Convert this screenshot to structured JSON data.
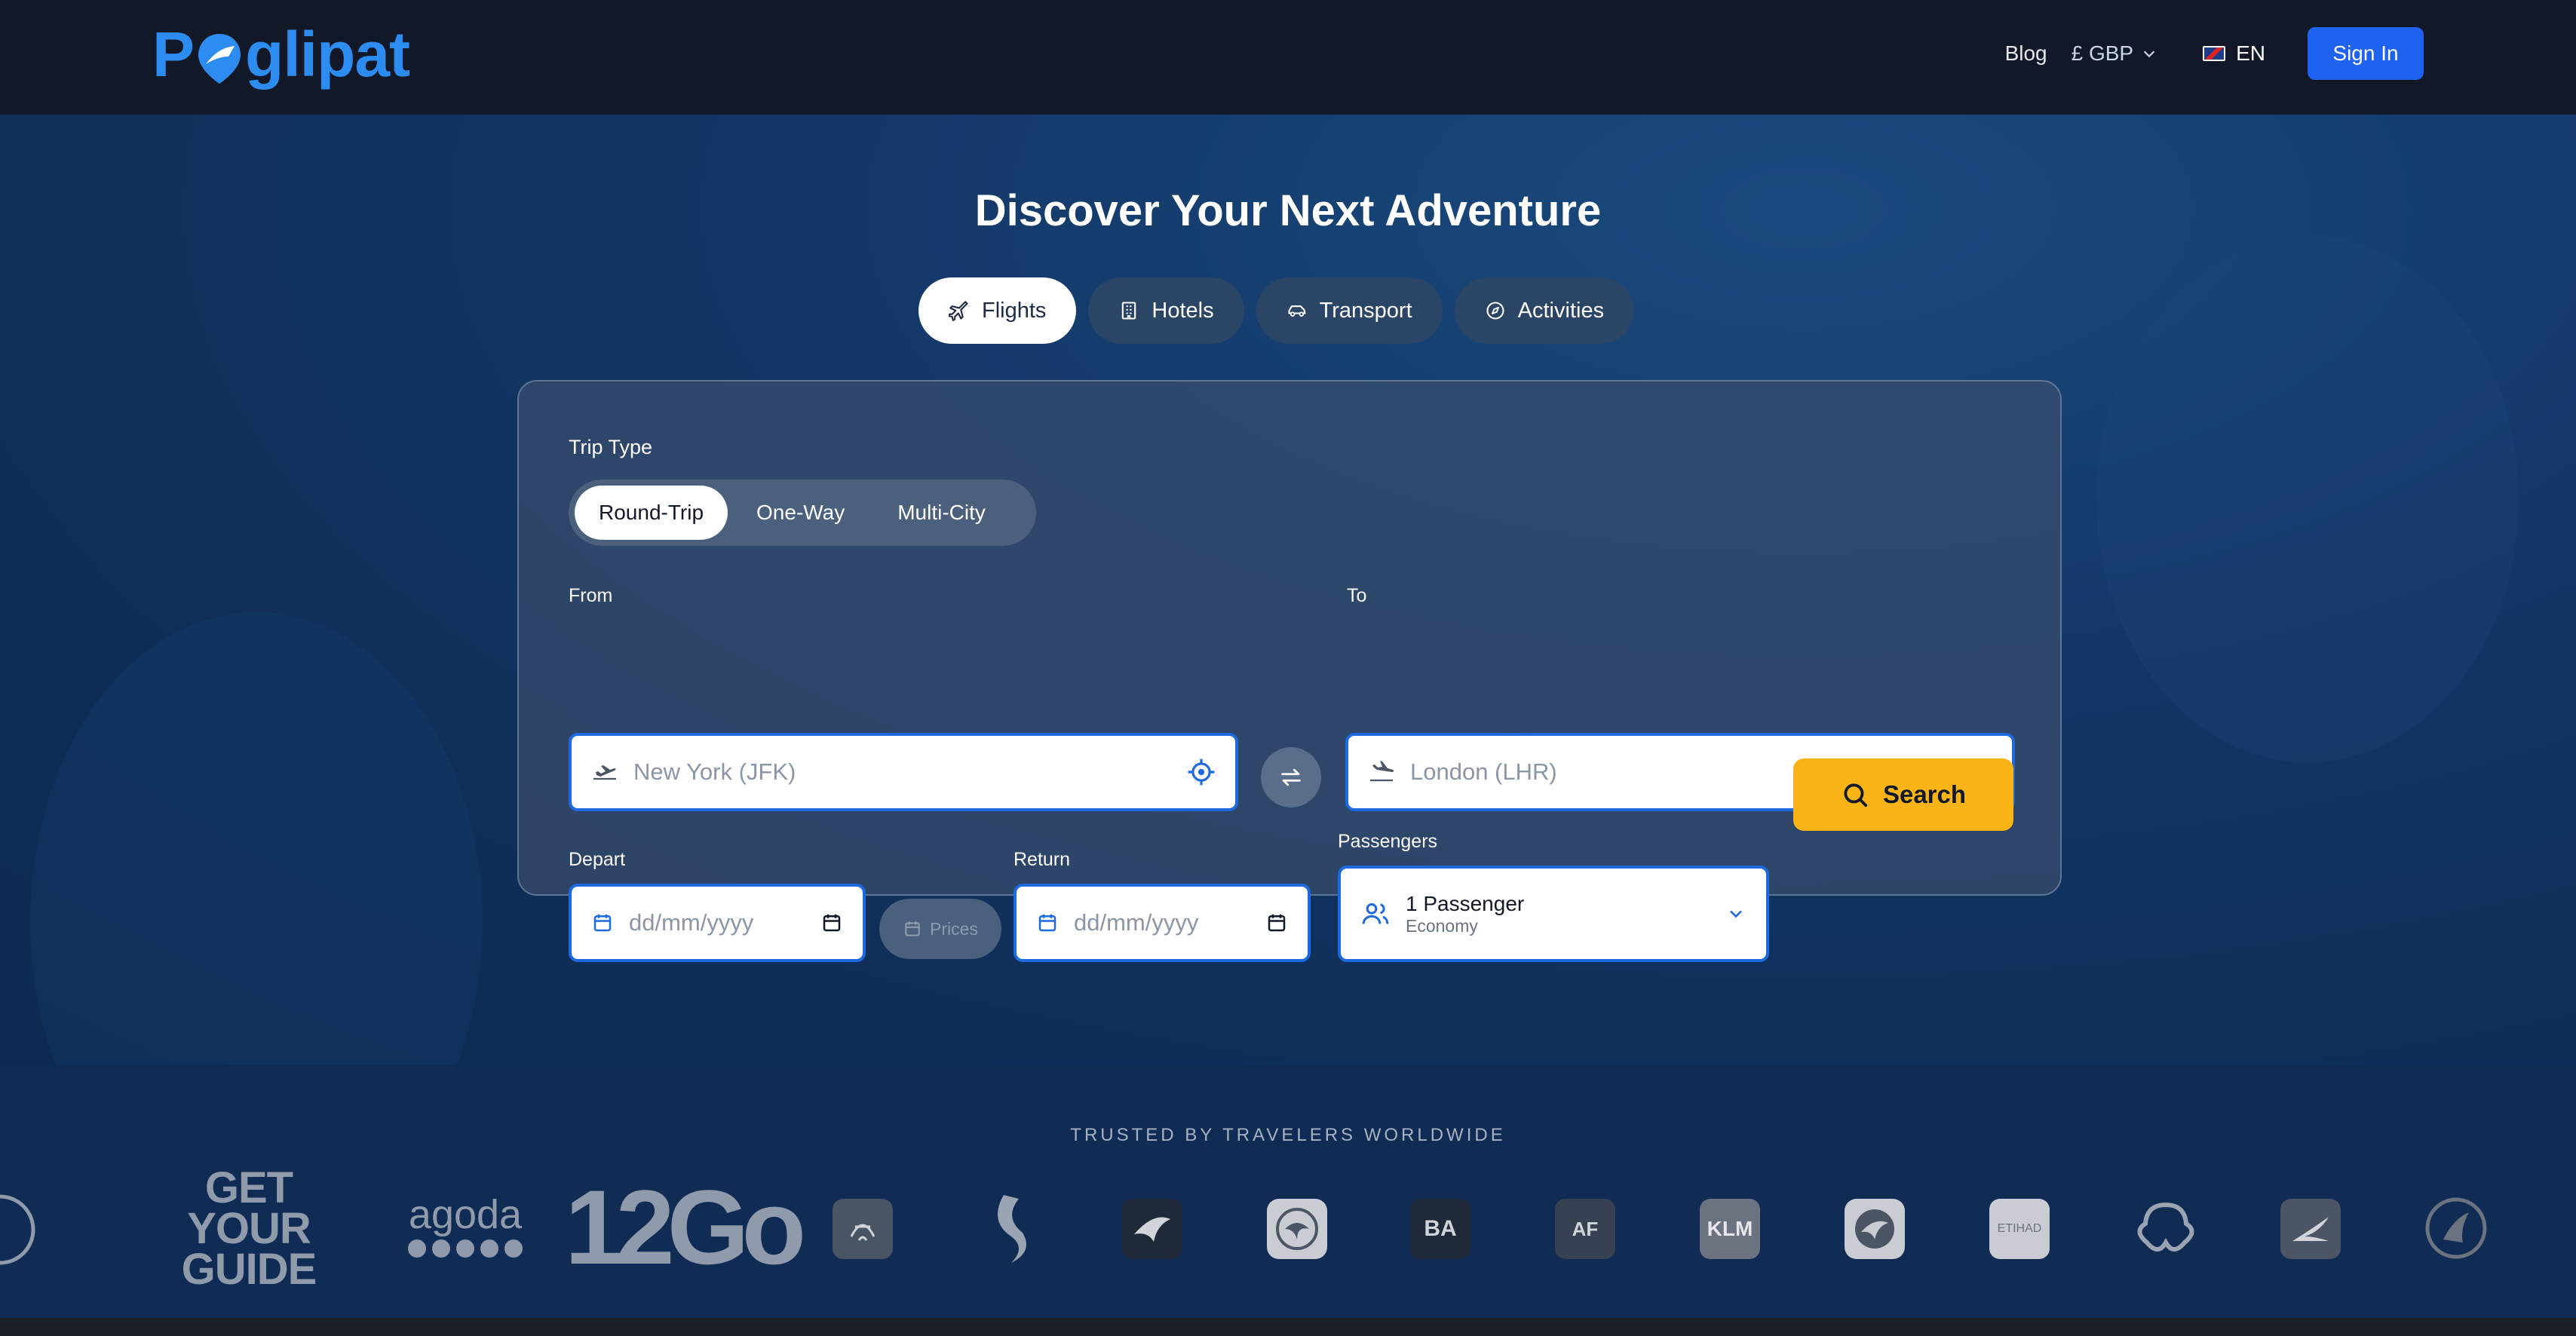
{
  "header": {
    "logo_text": "P glipat",
    "nav": {
      "blog": "Blog",
      "currency": "£ GBP",
      "language": "EN",
      "signin": "Sign In"
    }
  },
  "hero": {
    "headline": "Discover Your Next Adventure",
    "tabs": [
      {
        "label": "Flights",
        "icon": "plane-icon",
        "active": true
      },
      {
        "label": "Hotels",
        "icon": "building-icon",
        "active": false
      },
      {
        "label": "Transport",
        "icon": "car-icon",
        "active": false
      },
      {
        "label": "Activities",
        "icon": "compass-icon",
        "active": false
      }
    ]
  },
  "search": {
    "trip_type_label": "Trip Type",
    "trip_types": [
      "Round-Trip",
      "One-Way",
      "Multi-City"
    ],
    "active_trip_type": "Round-Trip",
    "from": {
      "label": "From",
      "placeholder": "New York (JFK)"
    },
    "to": {
      "label": "To",
      "placeholder": "London (LHR)"
    },
    "depart": {
      "label": "Depart",
      "placeholder": "dd/mm/yyyy"
    },
    "return": {
      "label": "Return",
      "placeholder": "dd/mm/yyyy"
    },
    "prices_chip": "Prices",
    "passengers": {
      "label": "Passengers",
      "value": "1 Passenger",
      "cabin": "Economy"
    },
    "search_button": "Search"
  },
  "trusted": {
    "title": "TRUSTED BY TRAVELERS WORLDWIDE",
    "partners": [
      {
        "name": "GET YOUR GUIDE",
        "lines": [
          "GET",
          "YOUR",
          "GUIDE"
        ]
      },
      {
        "name": "agoda"
      },
      {
        "name": "12Go"
      },
      {
        "name": "BA"
      },
      {
        "name": "AF"
      },
      {
        "name": "KLM"
      },
      {
        "name": "ETIHAD"
      }
    ]
  }
}
